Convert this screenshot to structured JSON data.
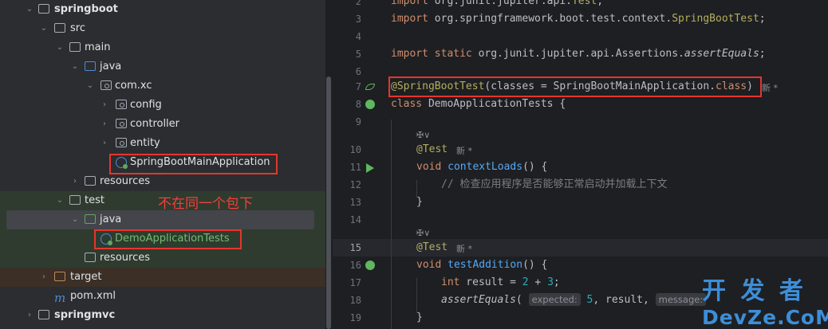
{
  "project_tree": {
    "items": [
      {
        "label": "springboot",
        "kind": "module",
        "expanded": true
      },
      {
        "label": "src",
        "kind": "folder",
        "expanded": true
      },
      {
        "label": "main",
        "kind": "folder",
        "expanded": true
      },
      {
        "label": "java",
        "kind": "source-root",
        "expanded": true
      },
      {
        "label": "com.xc",
        "kind": "package",
        "expanded": true
      },
      {
        "label": "config",
        "kind": "package",
        "expanded": false
      },
      {
        "label": "controller",
        "kind": "package",
        "expanded": false
      },
      {
        "label": "entity",
        "kind": "package",
        "expanded": false
      },
      {
        "label": "SpringBootMainApplication",
        "kind": "class"
      },
      {
        "label": "resources",
        "kind": "resource-root",
        "expanded": false
      },
      {
        "label": "test",
        "kind": "folder",
        "expanded": true
      },
      {
        "label": "java",
        "kind": "test-root",
        "expanded": true
      },
      {
        "label": "DemoApplicationTests",
        "kind": "test-class"
      },
      {
        "label": "resources",
        "kind": "test-resource-root"
      },
      {
        "label": "target",
        "kind": "excluded-folder",
        "expanded": false
      },
      {
        "label": "pom.xml",
        "kind": "maven-file"
      },
      {
        "label": "springmvc",
        "kind": "module",
        "expanded": false
      }
    ],
    "annotation": "不在同一个包下"
  },
  "editor": {
    "line_numbers": [
      "2",
      "3",
      "4",
      "5",
      "6",
      "7",
      "8",
      "9",
      "",
      "10",
      "11",
      "12",
      "13",
      "14",
      "",
      "15",
      "16",
      "17",
      "18",
      "19"
    ],
    "lines": {
      "l2": "import org.junit.jupiter.api.Test;",
      "l3_kw": "import",
      "l3_rest": " org.springframework.boot.test.context.",
      "l3_ann": "SpringBootTest",
      "l3_end": ";",
      "l5_kw": "import static",
      "l5_rest": " org.junit.jupiter.api.Assertions.",
      "l5_it": "assertEquals",
      "l5_end": ";",
      "l7_ann": "@SpringBootTest",
      "l7_mid": "(classes = SpringBootMainApplication.",
      "l7_kw": "class",
      "l7_end": ")",
      "l8_kw": "class",
      "l8_rest": " DemoApplicationTests {",
      "l10_ann": "@Test",
      "l11_kw": "void",
      "l11_fn": "contextLoads",
      "l11_end": "() {",
      "l12_cm": "// 检查应用程序是否能够正常启动并加载上下文",
      "l13": "}",
      "l15_ann": "@Test",
      "l16_kw": "void",
      "l16_fn": "testAddition",
      "l16_end": "() {",
      "l17_kw": "int",
      "l17_mid": " result = ",
      "l17_n1": "2",
      "l17_op": " + ",
      "l17_n2": "3",
      "l17_end": ";",
      "l18_it": "assertEquals",
      "l18_paren": "(",
      "l18_hint1": "expected:",
      "l18_n": " 5",
      "l18_mid": ", result, ",
      "l18_hint2": "message:",
      "l19": "}"
    },
    "author_hint": "✠∨",
    "new_marker": "新 *"
  },
  "watermark": {
    "line1": "开 发 者",
    "line2": "DevZe.CoM"
  }
}
